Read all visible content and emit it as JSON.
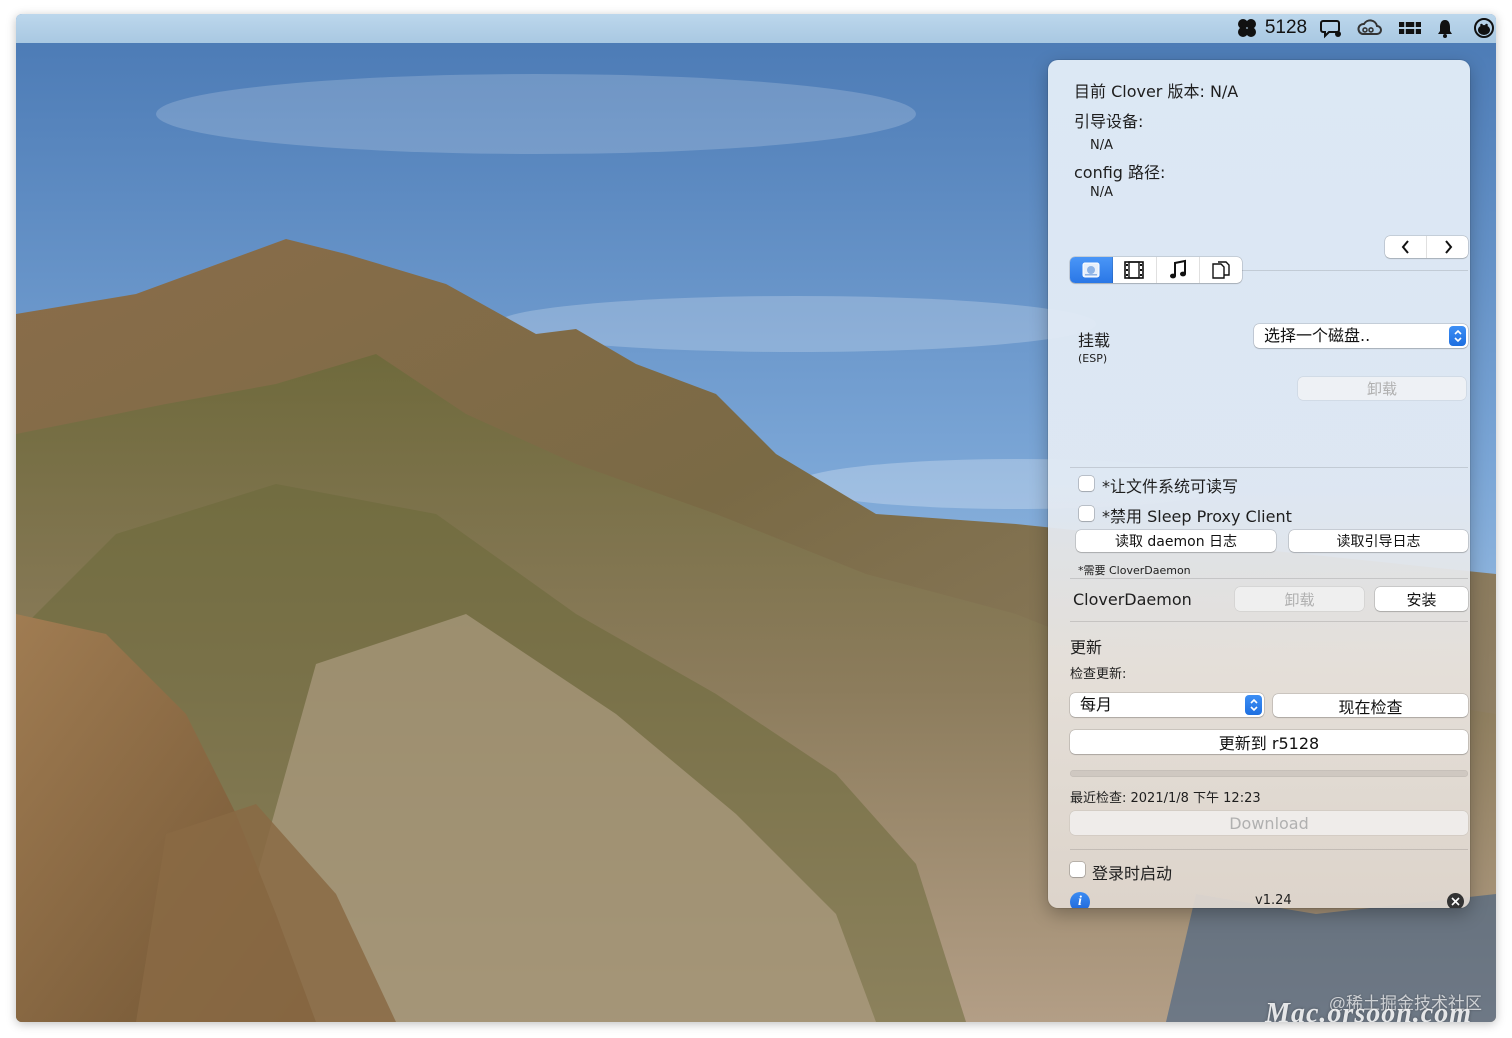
{
  "menubar": {
    "build_number": "5128",
    "icons": [
      "clover-icon",
      "chat-sync-icon",
      "creative-cloud-icon",
      "drive-icon",
      "bell-icon",
      "qq-penguin-icon"
    ]
  },
  "popover": {
    "version_label": "目前 Clover 版本: N/A",
    "boot_device_label": "引导设备:",
    "boot_device_value": "N/A",
    "config_path_label": "config 路径:",
    "config_path_value": "N/A",
    "tabs": [
      "disk-icon",
      "film-icon",
      "music-icon",
      "documents-icon"
    ],
    "active_tab": 0,
    "mount": {
      "label": "挂载",
      "sub_label": "(ESP)",
      "select_value": "选择一个磁盘..",
      "unmount_button": "卸载"
    },
    "options": {
      "writable_fs": "*让文件系统可读写",
      "disable_sleep_proxy": "*禁用 Sleep Proxy Client",
      "read_daemon_log": "读取 daemon 日志",
      "read_boot_log": "读取引导日志",
      "note": "*需要 CloverDaemon"
    },
    "daemon": {
      "label": "CloverDaemon",
      "uninstall_button": "卸载",
      "install_button": "安装"
    },
    "update": {
      "section_title": "更新",
      "check_label": "检查更新:",
      "frequency": "每月",
      "check_now_button": "现在检查",
      "update_to_button": "更新到 r5128",
      "progress": 0,
      "last_check": "最近检查: 2021/1/8 下午 12:23",
      "download_button": "Download"
    },
    "launch_at_login": "登录时启动",
    "version": "v1.24"
  },
  "watermark": {
    "line1": "@稀土掘金技术社区",
    "line2": "Mac.orsoon.com"
  },
  "colors": {
    "accent": "#2a77e6",
    "sky": "#6f9fcf"
  }
}
